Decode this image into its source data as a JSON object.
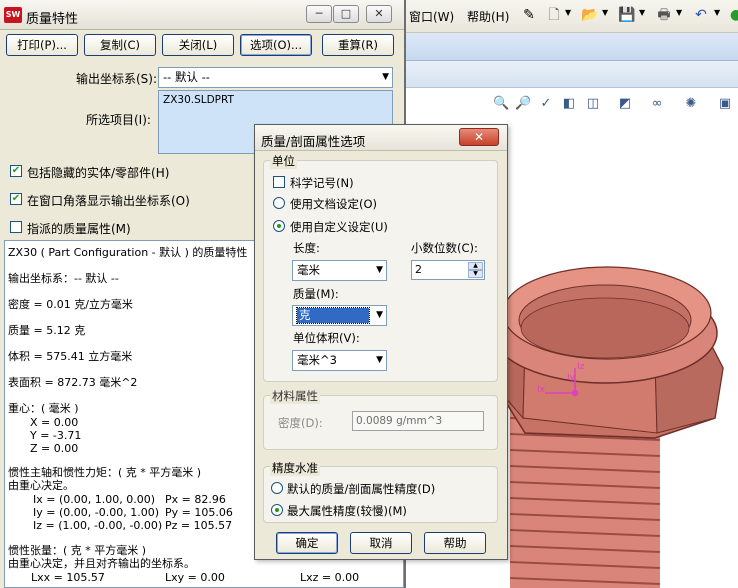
{
  "app": {
    "menu": [
      "窗口(W)",
      "帮助(H)"
    ]
  },
  "mass": {
    "title": "质量特性",
    "caption_buttons": [
      "─",
      "□",
      "✕"
    ],
    "buttons": {
      "print": "打印(P)...",
      "copy": "复制(C)",
      "close": "关闭(L)",
      "options": "选项(O)...",
      "recalc": "重算(R)"
    },
    "output_cs_label": "输出坐标系(S):",
    "output_cs_value": "-- 默认 --",
    "selected_items_label": "所选项目(I):",
    "selected_item": "ZX30.SLDPRT",
    "checkboxes": [
      {
        "label": "包括隐藏的实体/零部件(H)",
        "checked": true
      },
      {
        "label": "在窗口角落显示输出坐标系(O)",
        "checked": true
      },
      {
        "label": "指派的质量属性(M)",
        "checked": false
      }
    ],
    "report": {
      "header": "ZX30 ( Part Configuration - 默认 ) 的质量特性",
      "output_cs": "输出坐标系：-- 默认 --",
      "density": "密度 = 0.01 克/立方毫米",
      "mass": "质量 = 5.12 克",
      "volume": "体积 = 575.41 立方毫米",
      "area": "表面积 = 872.73 毫米^2",
      "cog_title": "重心：( 毫米 )",
      "cog_x": "X = 0.00",
      "cog_y": "Y = -3.71",
      "cog_z": "Z = 0.00",
      "pa_title": "惯性主轴和惯性力矩：( 克 * 平方毫米 )",
      "pa_sub": "由重心决定。",
      "ix": "Ix = (0.00, 1.00, 0.00)",
      "iy": "Iy = (0.00, -0.00, 1.00)",
      "iz": "Iz = (1.00, -0.00, -0.00)",
      "px": "Px = 82.96",
      "py": "Py = 105.06",
      "pz": "Pz = 105.57",
      "it_title": "惯性张量：( 克 * 平方毫米 )",
      "it_sub": "由重心决定，并且对齐输出的坐标系。",
      "lxx": "Lxx = 105.57",
      "lxy": "Lxy = 0.00",
      "lxz": "Lxz = 0.00"
    }
  },
  "dialog": {
    "title": "质量/剖面属性选项",
    "close": "✕",
    "units_group": "单位",
    "scientific": "科学记号(N)",
    "use_doc": "使用文档设定(O)",
    "use_custom": "使用自定义设定(U)",
    "length_label": "长度:",
    "length_value": "毫米",
    "decimals_label": "小数位数(C):",
    "decimals_value": "2",
    "mass_label": "质量(M):",
    "mass_value": "克",
    "per_volume_label": "单位体积(V):",
    "per_volume_value": "毫米^3",
    "material_group": "材料属性",
    "density_label": "密度(D):",
    "density_value": "0.0089 g/mm^3",
    "accuracy_group": "精度水准",
    "default_accuracy": "默认的质量/剖面属性精度(D)",
    "max_accuracy": "最大属性精度(较慢)(M)",
    "ok": "确定",
    "cancel": "取消",
    "help": "帮助"
  },
  "model": {
    "axis_labels": [
      "Ix",
      "Iy",
      "Iz"
    ]
  },
  "colors": {
    "bolt": "#d9857a",
    "selection": "#cfe3f8",
    "dialog_bg": "#ece9d8"
  }
}
